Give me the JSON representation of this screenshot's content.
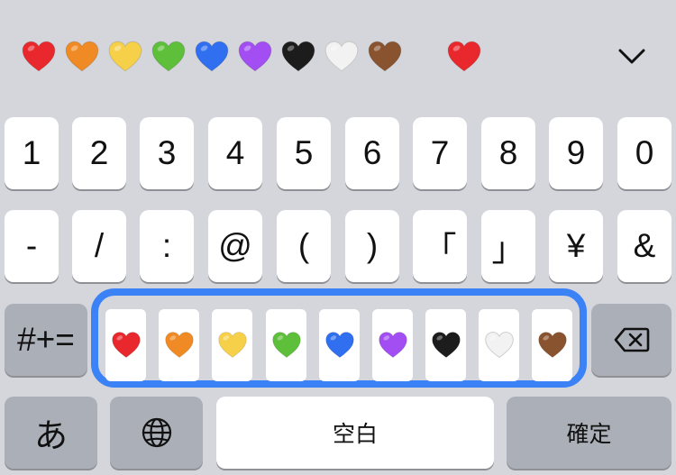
{
  "suggestion_bar": {
    "hearts": [
      {
        "name": "red-heart",
        "color": "#e8282c"
      },
      {
        "name": "orange-heart",
        "color": "#f08a24"
      },
      {
        "name": "yellow-heart",
        "color": "#f7d04a"
      },
      {
        "name": "green-heart",
        "color": "#5ebf3a"
      },
      {
        "name": "blue-heart",
        "color": "#2f6ff0"
      },
      {
        "name": "purple-heart",
        "color": "#a24ef2"
      },
      {
        "name": "black-heart",
        "color": "#1c1c1c"
      },
      {
        "name": "white-heart",
        "color": "#f2f2f2"
      },
      {
        "name": "brown-heart",
        "color": "#8a5330"
      },
      {
        "name": "red-heart",
        "color": "#e8282c"
      }
    ],
    "collapse_icon": "chevron-down-icon"
  },
  "keyboard": {
    "row1": [
      "1",
      "2",
      "3",
      "4",
      "5",
      "6",
      "7",
      "8",
      "9",
      "0"
    ],
    "row2": [
      "-",
      "/",
      ":",
      "@",
      "(",
      ")",
      "「",
      "」",
      "¥",
      "&"
    ],
    "symbols_key": "#+=",
    "delete_icon": "backspace-icon",
    "row4": {
      "kana_key": "あ",
      "globe_icon": "globe-icon",
      "space_key": "空白",
      "confirm_key": "確定"
    }
  },
  "heart_picker": {
    "highlight_color": "#3c82f7",
    "options": [
      {
        "name": "red-heart",
        "color": "#e8282c"
      },
      {
        "name": "orange-heart",
        "color": "#f08a24"
      },
      {
        "name": "yellow-heart",
        "color": "#f7d04a"
      },
      {
        "name": "green-heart",
        "color": "#5ebf3a"
      },
      {
        "name": "blue-heart",
        "color": "#2f6ff0"
      },
      {
        "name": "purple-heart",
        "color": "#a24ef2"
      },
      {
        "name": "black-heart",
        "color": "#1c1c1c"
      },
      {
        "name": "white-heart",
        "color": "#f2f2f2"
      },
      {
        "name": "brown-heart",
        "color": "#8a5330"
      }
    ]
  }
}
